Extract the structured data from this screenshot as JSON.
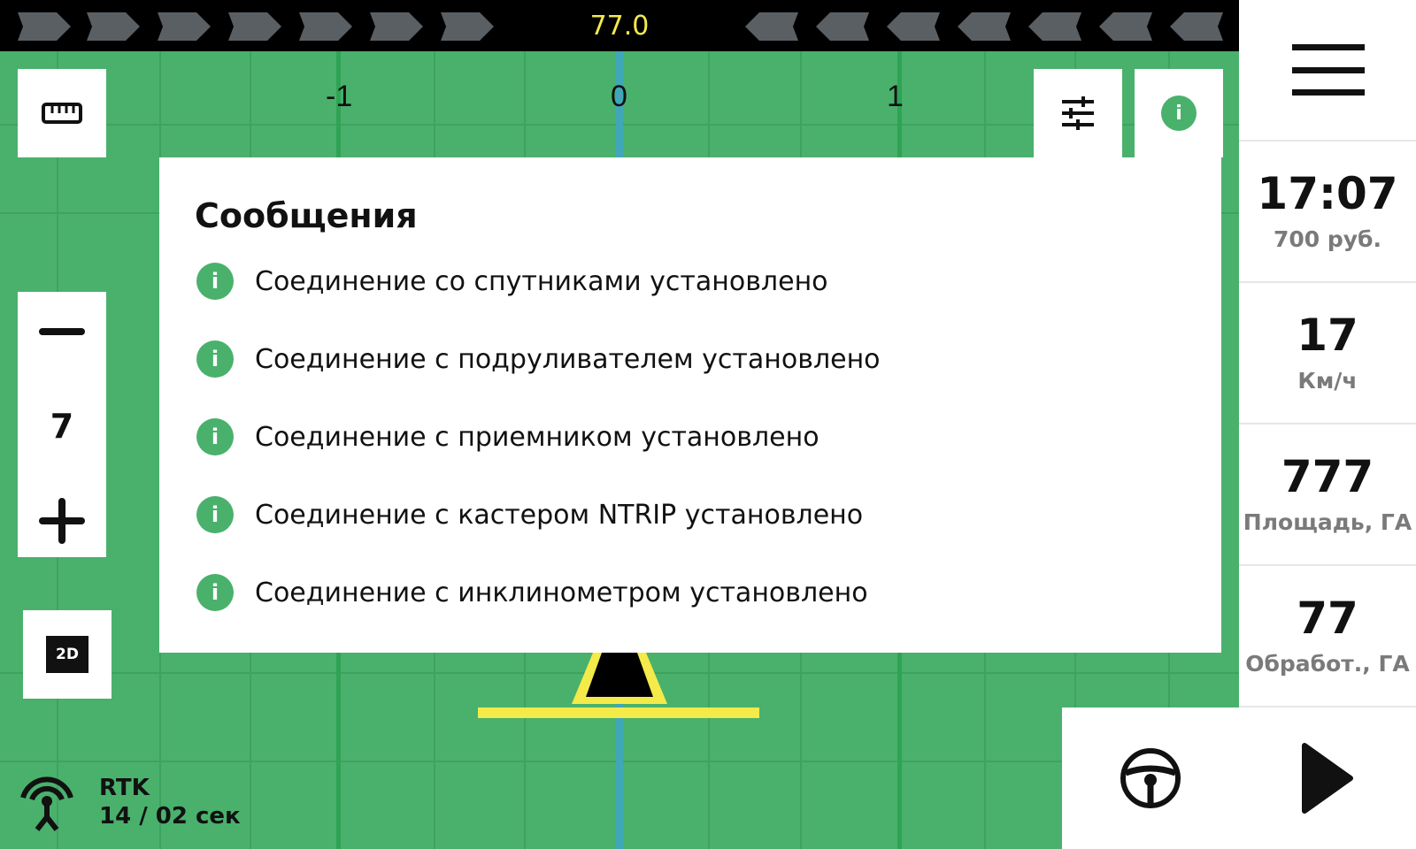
{
  "lightbar": {
    "heading": "77.0",
    "left_chevrons": 7,
    "right_chevrons": 7
  },
  "scale": {
    "labels": [
      "-1",
      "0",
      "1"
    ]
  },
  "zoom": {
    "minus_label": "—",
    "level": "7",
    "plus_label": "+"
  },
  "view_mode": {
    "label": "2D"
  },
  "messages": {
    "title": "Сообщения",
    "items": [
      {
        "icon": "i",
        "text": "Соединение со спутниками установлено"
      },
      {
        "icon": "i",
        "text": "Соединение с подруливателем установлено"
      },
      {
        "icon": "i",
        "text": "Соединение с приемником установлено"
      },
      {
        "icon": "i",
        "text": "Соединение с кастером NTRIP установлено"
      },
      {
        "icon": "i",
        "text": "Соединение с инклинометром установлено"
      }
    ]
  },
  "sidebar": {
    "time": "17:07",
    "price": "700 руб.",
    "speed": "17",
    "speed_unit": "Км/ч",
    "area": "777",
    "area_unit": "Площадь, ГА",
    "processed": "77",
    "processed_unit": "Обработ., ГА"
  },
  "gps": {
    "mode": "RTK",
    "status": "14 / 02 сек"
  },
  "icons": {
    "ruler": "ruler-icon",
    "settings": "sliders-icon",
    "info": "info-icon",
    "menu": "hamburger-icon",
    "steering": "steering-wheel-icon",
    "play": "play-icon",
    "antenna": "antenna-icon"
  },
  "colors": {
    "field": "#49b16c",
    "accent_yellow": "#f4ea4a",
    "center_line": "#3fa7b8",
    "info_green": "#49b16c"
  }
}
